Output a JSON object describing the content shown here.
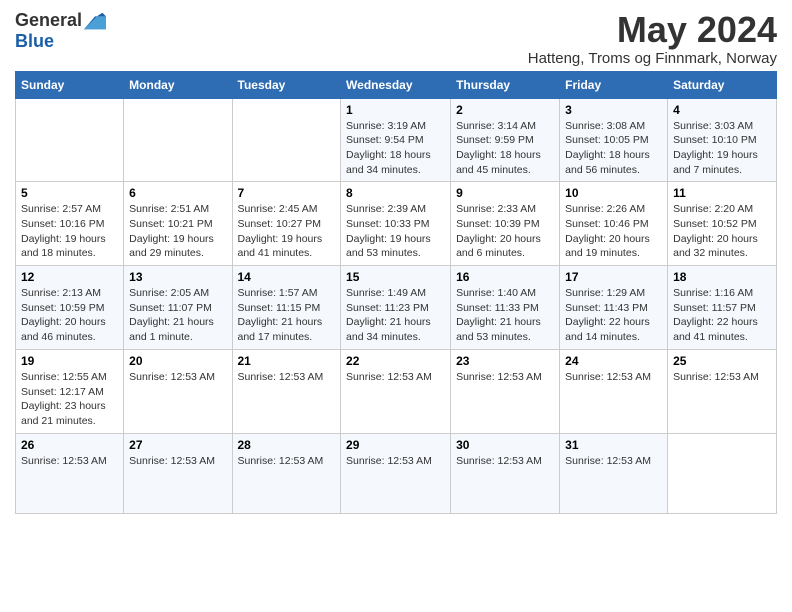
{
  "logo": {
    "general": "General",
    "blue": "Blue"
  },
  "title": "May 2024",
  "subtitle": "Hatteng, Troms og Finnmark, Norway",
  "headers": [
    "Sunday",
    "Monday",
    "Tuesday",
    "Wednesday",
    "Thursday",
    "Friday",
    "Saturday"
  ],
  "weeks": [
    [
      {
        "day": "",
        "info": ""
      },
      {
        "day": "",
        "info": ""
      },
      {
        "day": "",
        "info": ""
      },
      {
        "day": "1",
        "info": "Sunrise: 3:19 AM\nSunset: 9:54 PM\nDaylight: 18 hours and 34 minutes."
      },
      {
        "day": "2",
        "info": "Sunrise: 3:14 AM\nSunset: 9:59 PM\nDaylight: 18 hours and 45 minutes."
      },
      {
        "day": "3",
        "info": "Sunrise: 3:08 AM\nSunset: 10:05 PM\nDaylight: 18 hours and 56 minutes."
      },
      {
        "day": "4",
        "info": "Sunrise: 3:03 AM\nSunset: 10:10 PM\nDaylight: 19 hours and 7 minutes."
      }
    ],
    [
      {
        "day": "5",
        "info": "Sunrise: 2:57 AM\nSunset: 10:16 PM\nDaylight: 19 hours and 18 minutes."
      },
      {
        "day": "6",
        "info": "Sunrise: 2:51 AM\nSunset: 10:21 PM\nDaylight: 19 hours and 29 minutes."
      },
      {
        "day": "7",
        "info": "Sunrise: 2:45 AM\nSunset: 10:27 PM\nDaylight: 19 hours and 41 minutes."
      },
      {
        "day": "8",
        "info": "Sunrise: 2:39 AM\nSunset: 10:33 PM\nDaylight: 19 hours and 53 minutes."
      },
      {
        "day": "9",
        "info": "Sunrise: 2:33 AM\nSunset: 10:39 PM\nDaylight: 20 hours and 6 minutes."
      },
      {
        "day": "10",
        "info": "Sunrise: 2:26 AM\nSunset: 10:46 PM\nDaylight: 20 hours and 19 minutes."
      },
      {
        "day": "11",
        "info": "Sunrise: 2:20 AM\nSunset: 10:52 PM\nDaylight: 20 hours and 32 minutes."
      }
    ],
    [
      {
        "day": "12",
        "info": "Sunrise: 2:13 AM\nSunset: 10:59 PM\nDaylight: 20 hours and 46 minutes."
      },
      {
        "day": "13",
        "info": "Sunrise: 2:05 AM\nSunset: 11:07 PM\nDaylight: 21 hours and 1 minute."
      },
      {
        "day": "14",
        "info": "Sunrise: 1:57 AM\nSunset: 11:15 PM\nDaylight: 21 hours and 17 minutes."
      },
      {
        "day": "15",
        "info": "Sunrise: 1:49 AM\nSunset: 11:23 PM\nDaylight: 21 hours and 34 minutes."
      },
      {
        "day": "16",
        "info": "Sunrise: 1:40 AM\nSunset: 11:33 PM\nDaylight: 21 hours and 53 minutes."
      },
      {
        "day": "17",
        "info": "Sunrise: 1:29 AM\nSunset: 11:43 PM\nDaylight: 22 hours and 14 minutes."
      },
      {
        "day": "18",
        "info": "Sunrise: 1:16 AM\nSunset: 11:57 PM\nDaylight: 22 hours and 41 minutes."
      }
    ],
    [
      {
        "day": "19",
        "info": "Sunrise: 12:55 AM\nSunset: 12:17 AM\nDaylight: 23 hours and 21 minutes."
      },
      {
        "day": "20",
        "info": "Sunrise: 12:53 AM"
      },
      {
        "day": "21",
        "info": "Sunrise: 12:53 AM"
      },
      {
        "day": "22",
        "info": "Sunrise: 12:53 AM"
      },
      {
        "day": "23",
        "info": "Sunrise: 12:53 AM"
      },
      {
        "day": "24",
        "info": "Sunrise: 12:53 AM"
      },
      {
        "day": "25",
        "info": "Sunrise: 12:53 AM"
      }
    ],
    [
      {
        "day": "26",
        "info": "Sunrise: 12:53 AM"
      },
      {
        "day": "27",
        "info": "Sunrise: 12:53 AM"
      },
      {
        "day": "28",
        "info": "Sunrise: 12:53 AM"
      },
      {
        "day": "29",
        "info": "Sunrise: 12:53 AM"
      },
      {
        "day": "30",
        "info": "Sunrise: 12:53 AM"
      },
      {
        "day": "31",
        "info": "Sunrise: 12:53 AM"
      },
      {
        "day": "",
        "info": ""
      }
    ]
  ]
}
